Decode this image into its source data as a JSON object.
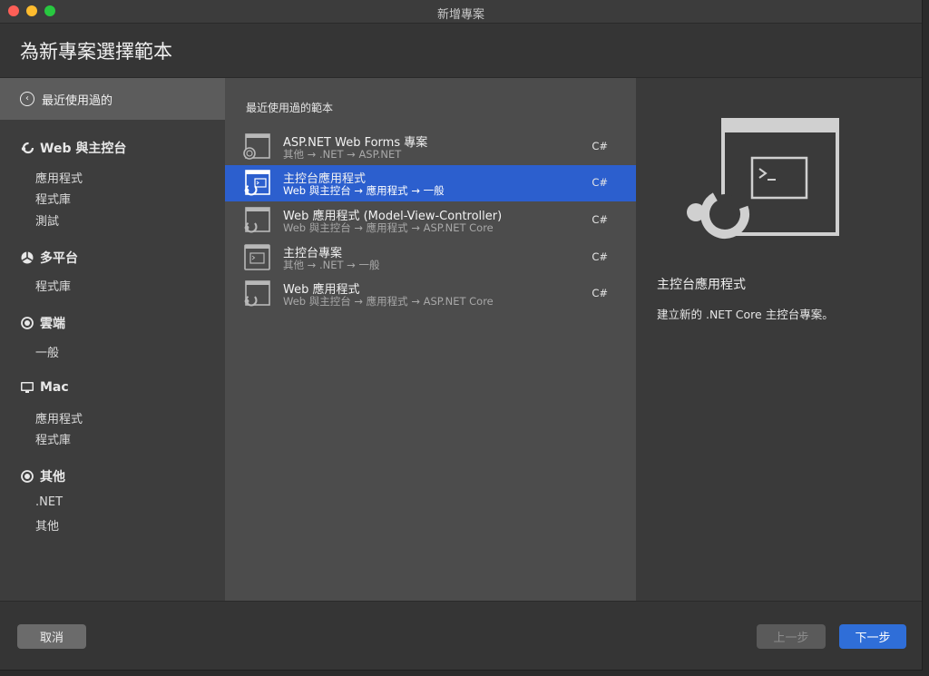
{
  "window": {
    "title": "新增專案"
  },
  "header": {
    "title": "為新專案選擇範本"
  },
  "sidebar": {
    "recent_label": "最近使用過的",
    "categories": [
      {
        "label": "Web 與主控台",
        "icon": "web-console-icon",
        "items": [
          "應用程式",
          "程式庫",
          "測試"
        ]
      },
      {
        "label": "多平台",
        "icon": "multiplatform-icon",
        "items": [
          "程式庫"
        ]
      },
      {
        "label": "雲端",
        "icon": "cloud-icon",
        "items": [
          "一般"
        ]
      },
      {
        "label": "Mac",
        "icon": "mac-monitor-icon",
        "items": [
          "應用程式",
          "程式庫"
        ]
      },
      {
        "label": "其他",
        "icon": "other-icon",
        "items": [
          ".NET",
          "其他"
        ]
      }
    ]
  },
  "templates": {
    "section_title": "最近使用過的範本",
    "items": [
      {
        "name": "ASP.NET Web Forms 專案",
        "path": "其他 → .NET → ASP.NET",
        "lang": "C#",
        "icon": "web-forms-icon",
        "selected": false
      },
      {
        "name": "主控台應用程式",
        "path": "Web 與主控台 → 應用程式 → 一般",
        "lang": "C#",
        "icon": "console-app-icon",
        "selected": true
      },
      {
        "name": "Web 應用程式 (Model-View-Controller)",
        "path": "Web 與主控台 → 應用程式 → ASP.NET Core",
        "lang": "C#",
        "icon": "web-app-icon",
        "selected": false
      },
      {
        "name": "主控台專案",
        "path": "其他 → .NET → 一般",
        "lang": "C#",
        "icon": "console-project-icon",
        "selected": false
      },
      {
        "name": "Web 應用程式",
        "path": "Web 與主控台 → 應用程式 → ASP.NET Core",
        "lang": "C#",
        "icon": "web-app-icon",
        "selected": false
      }
    ]
  },
  "preview": {
    "title": "主控台應用程式",
    "description": "建立新的 .NET Core 主控台專案。"
  },
  "footer": {
    "cancel_label": "取消",
    "prev_label": "上一步",
    "next_label": "下一步"
  },
  "colors": {
    "selection": "#2c5fce",
    "primary_button": "#2f6ed8"
  }
}
